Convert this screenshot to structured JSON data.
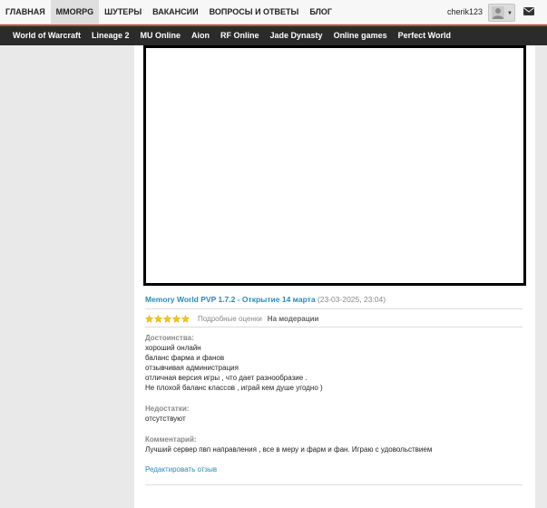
{
  "top_nav": {
    "items": [
      "ГЛАВНАЯ",
      "MMORPG",
      "ШУТЕРЫ",
      "ВАКАНСИИ",
      "ВОПРОСЫ И ОТВЕТЫ",
      "БЛОГ"
    ],
    "active": "MMORPG",
    "username": "cherik123"
  },
  "game_nav": {
    "items": [
      "World of Warcraft",
      "Lineage 2",
      "MU Online",
      "Aion",
      "RF Online",
      "Jade Dynasty",
      "Online games",
      "Perfect World"
    ]
  },
  "review": {
    "title": "Memory World PVP 1.7.2 - Открытие 14 марта",
    "date": "(23-03-2025, 23:04)",
    "stars": 5,
    "details_link": "Подробные оценки",
    "status": "На модерации",
    "pros_label": "Достоинства:",
    "pros": [
      "хороший онлайн",
      "баланс фарма и фанов",
      "отзывчивая администрация",
      "отличная версия игры , что дает разнообразие .",
      "Не плохой баланс классов , играй кем душе угодно )"
    ],
    "cons_label": "Недостатки:",
    "cons": "отсутствуют",
    "comment_label": "Комментарий:",
    "comment": "Лучший сервер пвп направления , все в меру и фарм и фан. Играю с удовольствием",
    "edit_link": "Редактировать отзыв"
  },
  "colors": {
    "accent_orange": "#c0502a",
    "link_blue": "#2a8ab7",
    "star_yellow": "#f0c419",
    "dark_bar": "#2b2b2b"
  }
}
